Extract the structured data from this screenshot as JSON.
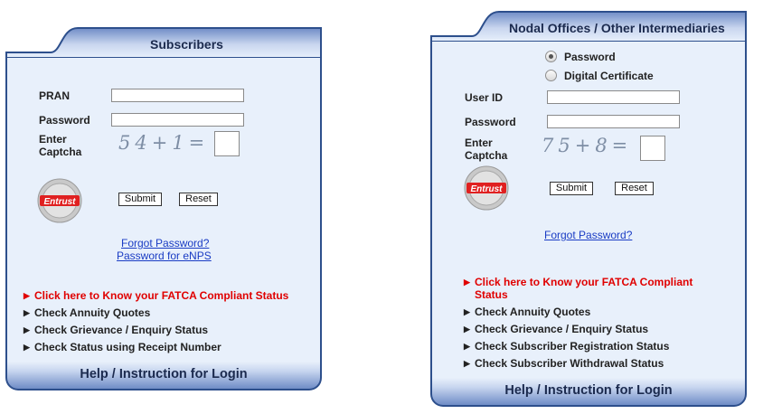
{
  "subscribers": {
    "title": "Subscribers",
    "pran_label": "PRAN",
    "password_label": "Password",
    "captcha_label_line1": "Enter",
    "captcha_label_line2": "Captcha",
    "captcha_text": "54+1=",
    "submit_label": "Submit",
    "reset_label": "Reset",
    "links": [
      "Forgot Password?",
      "Password for eNPS"
    ],
    "menu": [
      "Click here to Know your FATCA Compliant Status",
      "Check Annuity Quotes",
      "Check Grievance / Enquiry Status",
      "Check Status using Receipt Number"
    ],
    "footer": "Help / Instruction for Login"
  },
  "nodal": {
    "title": "Nodal Offices / Other Intermediaries",
    "radio_password": "Password",
    "radio_certificate": "Digital Certificate",
    "selected_auth": "Password",
    "userid_label": "User ID",
    "password_label": "Password",
    "captcha_label_line1": "Enter",
    "captcha_label_line2": "Captcha",
    "captcha_text": "75+8=",
    "submit_label": "Submit",
    "reset_label": "Reset",
    "forgot_link": "Forgot Password?",
    "menu": [
      "Click here to Know your FATCA Compliant Status",
      "Check Annuity Quotes",
      "Check Grievance / Enquiry Status",
      "Check Subscriber Registration Status",
      "Check Subscriber Withdrawal Status"
    ],
    "footer": "Help / Instruction for Login"
  },
  "seal_text": "Entrust",
  "colors": {
    "border": "#2d4f8c",
    "panel_bg": "#e8f0fb",
    "alert_red": "#e00000",
    "link_blue": "#1a3cc4"
  }
}
